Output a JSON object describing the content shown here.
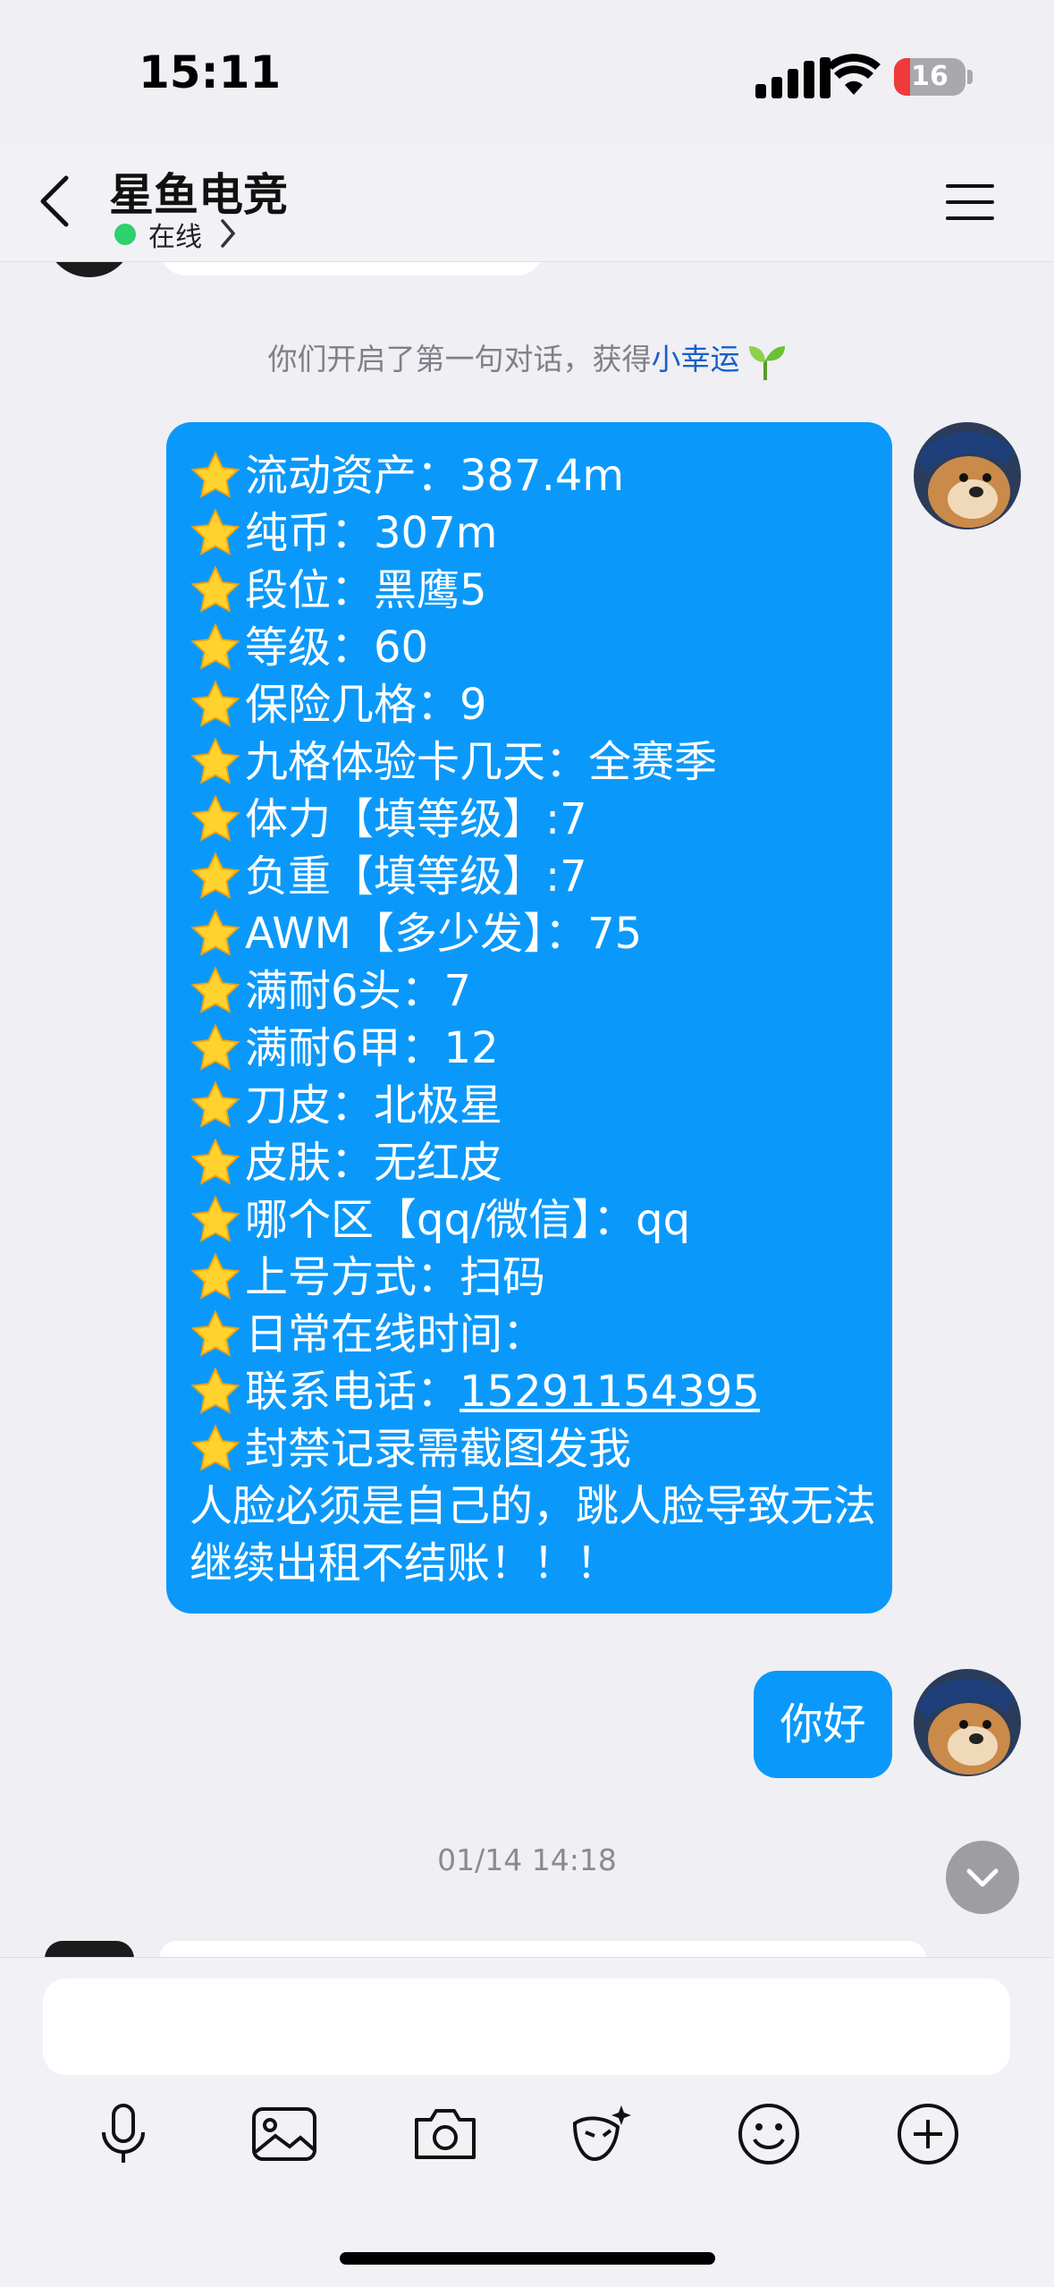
{
  "status_bar": {
    "time": "15:11",
    "battery": "16"
  },
  "header": {
    "title": "星鱼电竞",
    "status": "在线"
  },
  "notice": {
    "prefix": "你们开启了第一句对话，获得",
    "highlight": "小幸运"
  },
  "messages": {
    "big": {
      "lines": [
        "流动资产：387.4m",
        "纯币：307m",
        "段位：黑鹰5",
        "等级：60",
        "保险几格：9",
        "九格体验卡几天：全赛季",
        "体力【填等级】:7",
        "负重【填等级】:7",
        "AWM【多少发】：75",
        "满耐6头：7",
        "满耐6甲：12",
        "刀皮：北极星",
        "皮肤：无红皮",
        "哪个区【qq/微信】：qq",
        "上号方式：扫码",
        "日常在线时间：",
        "联系电话：",
        "封禁记录需截图发我"
      ],
      "phone": "15291154395",
      "footer": "人脸必须是自己的，跳人脸导致无法继续出租不结账！！！"
    },
    "small": "你好",
    "timestamp": "01/14 14:18"
  },
  "input": {
    "placeholder": ""
  },
  "colors": {
    "bubble": "#0a99fb",
    "online": "#2ed16b",
    "link": "#1a5fc7"
  },
  "icons": [
    "back-icon",
    "menu-icon",
    "chevron-right-icon",
    "star-icon",
    "sprout-icon",
    "chevron-down-icon",
    "microphone-icon",
    "image-icon",
    "camera-icon",
    "sticker-icon",
    "emoji-icon",
    "plus-icon"
  ]
}
